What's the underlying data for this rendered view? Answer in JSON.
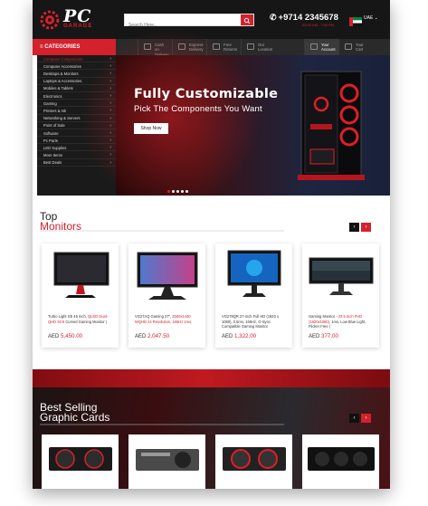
{
  "brand": {
    "logo_main": "PC",
    "logo_sub": "GARAGE"
  },
  "search": {
    "placeholder": "Search Here.."
  },
  "contact": {
    "phone": "+9714 2345678",
    "hours": "00:00 AM - 7:00 PM"
  },
  "locale": {
    "language": "UAE"
  },
  "nav": {
    "categories_label": "CATEGORIES",
    "items": [
      {
        "line1": "Cash",
        "line2": "on Delivery"
      },
      {
        "line1": "Express",
        "line2": "Delivery"
      },
      {
        "line1": "Free",
        "line2": "Returns"
      },
      {
        "line1": "Our",
        "line2": "Location"
      },
      {
        "line1": "Your",
        "line2": "Account"
      },
      {
        "line1": "Your",
        "line2": "Cart"
      }
    ]
  },
  "sidebar": {
    "items": [
      "Computer Components",
      "Computer Accessories",
      "Desktops & Monitors",
      "Laptops & Accessories",
      "Mobiles & Tablets",
      "Electronics",
      "Gaming",
      "Printers & Ink",
      "Networking & Servers",
      "Point of Sale",
      "Software",
      "Pc Parts",
      "LED Supplies",
      "More Items",
      "Best Deals"
    ]
  },
  "hero": {
    "title": "Fully Customizable",
    "subtitle": "Pick The Components You Want",
    "button": "Shop Now"
  },
  "monitors": {
    "title": "Top",
    "subtitle": "Monitors",
    "products": [
      {
        "name_pre": "Turbo Light G5 45 Inch, ",
        "name_hl": "QLED Dual-QHD 32:9",
        "name_post": " Curved Gaming Monitor |",
        "currency": "AED",
        "price": "5,450.00"
      },
      {
        "name_pre": "VG27AQ Gaming 27\", ",
        "name_hl": "2560x1440 WQHD 24 Resolution, 165Hz 1ms,",
        "name_post": "",
        "currency": "AED",
        "price": "2,047.50"
      },
      {
        "name_pre": "VG278QR 27-inch Full HD (1920 x 1080), 0.5ms, 165Hz, G-Sync Compatible Gaming Monitor",
        "name_hl": "",
        "name_post": "",
        "currency": "AED",
        "price": "1,322.00"
      },
      {
        "name_pre": "Gaming Monitor - ",
        "name_hl": "23.5 Inch FHD (1920x1080)",
        "name_post": ", 1ms, Low Blue Light, Flicker Free |",
        "currency": "AED",
        "price": "377.00"
      }
    ]
  },
  "graphics": {
    "title": "Best Selling",
    "subtitle": "Graphic Cards"
  },
  "colors": {
    "accent": "#d4212b",
    "dark": "#161616",
    "nav": "#2a2a2a"
  }
}
